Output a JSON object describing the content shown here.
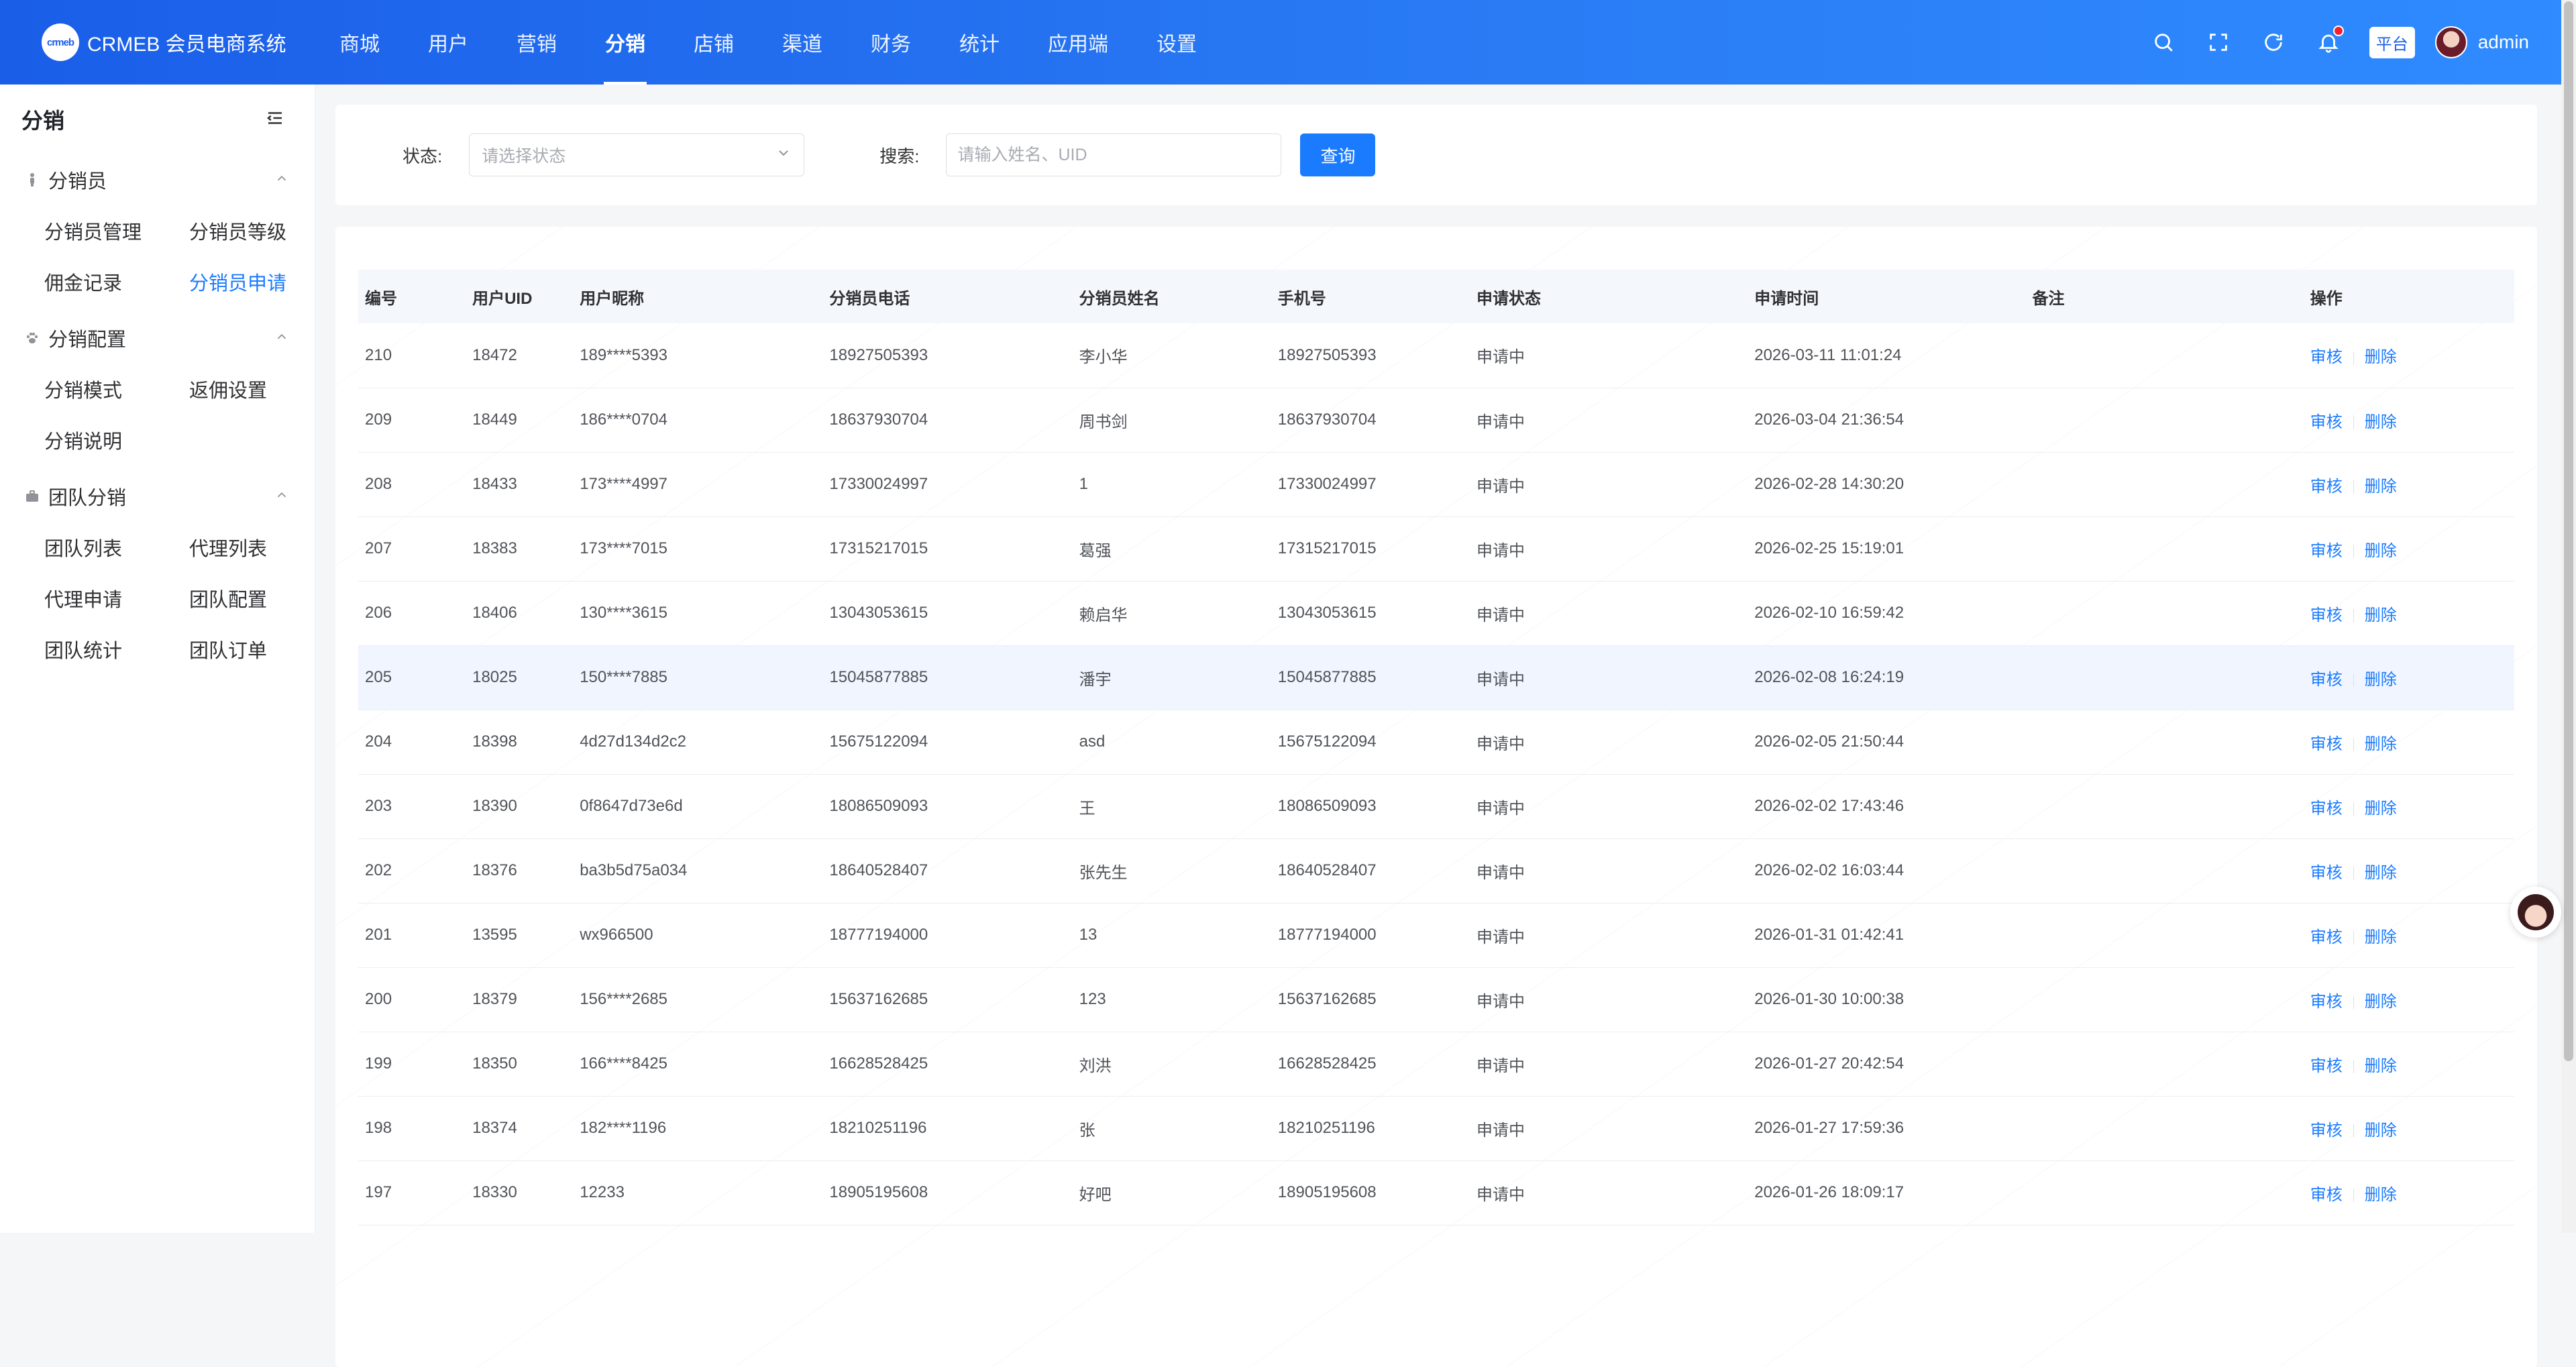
{
  "brand": {
    "logo_text": "crmeb",
    "name": "CRMEB 会员电商系统"
  },
  "top_nav": [
    {
      "label": "商城"
    },
    {
      "label": "用户"
    },
    {
      "label": "营销"
    },
    {
      "label": "分销",
      "active": true
    },
    {
      "label": "店铺"
    },
    {
      "label": "渠道"
    },
    {
      "label": "财务"
    },
    {
      "label": "统计"
    },
    {
      "label": "应用端"
    },
    {
      "label": "设置"
    }
  ],
  "header_right": {
    "platform_tag": "平台",
    "username": "admin"
  },
  "sidebar": {
    "title": "分销",
    "groups": [
      {
        "label": "分销员",
        "icon": "person-icon",
        "items": [
          "分销员管理",
          "分销员等级",
          "佣金记录",
          "分销员申请"
        ]
      },
      {
        "label": "分销配置",
        "icon": "paw-icon",
        "items": [
          "分销模式",
          "返佣设置",
          "分销说明"
        ]
      },
      {
        "label": "团队分销",
        "icon": "briefcase-icon",
        "items": [
          "团队列表",
          "代理列表",
          "代理申请",
          "团队配置",
          "团队统计",
          "团队订单"
        ]
      }
    ],
    "active_item": "分销员申请"
  },
  "filter": {
    "status_label": "状态:",
    "status_placeholder": "请选择状态",
    "search_label": "搜索:",
    "search_placeholder": "请输入姓名、UID",
    "query_button": "查询"
  },
  "table": {
    "headers": [
      "编号",
      "用户UID",
      "用户昵称",
      "分销员电话",
      "分销员姓名",
      "手机号",
      "申请状态",
      "申请时间",
      "备注",
      "操作"
    ],
    "actions": {
      "review": "审核",
      "delete": "删除"
    },
    "rows": [
      [
        "210",
        "18472",
        "189****5393",
        "18927505393",
        "李小华",
        "18927505393",
        "申请中",
        "2026-03-11 11:01:24",
        ""
      ],
      [
        "209",
        "18449",
        "186****0704",
        "18637930704",
        "周书剑",
        "18637930704",
        "申请中",
        "2026-03-04 21:36:54",
        ""
      ],
      [
        "208",
        "18433",
        "173****4997",
        "17330024997",
        "1",
        "17330024997",
        "申请中",
        "2026-02-28 14:30:20",
        ""
      ],
      [
        "207",
        "18383",
        "173****7015",
        "17315217015",
        "葛强",
        "17315217015",
        "申请中",
        "2026-02-25 15:19:01",
        ""
      ],
      [
        "206",
        "18406",
        "130****3615",
        "13043053615",
        "赖启华",
        "13043053615",
        "申请中",
        "2026-02-10 16:59:42",
        ""
      ],
      [
        "205",
        "18025",
        "150****7885",
        "15045877885",
        "潘宇",
        "15045877885",
        "申请中",
        "2026-02-08 16:24:19",
        ""
      ],
      [
        "204",
        "18398",
        "4d27d134d2c2",
        "15675122094",
        "asd",
        "15675122094",
        "申请中",
        "2026-02-05 21:50:44",
        ""
      ],
      [
        "203",
        "18390",
        "0f8647d73e6d",
        "18086509093",
        "王",
        "18086509093",
        "申请中",
        "2026-02-02 17:43:46",
        ""
      ],
      [
        "202",
        "18376",
        "ba3b5d75a034",
        "18640528407",
        "张先生",
        "18640528407",
        "申请中",
        "2026-02-02 16:03:44",
        ""
      ],
      [
        "201",
        "13595",
        "wx966500",
        "18777194000",
        "13",
        "18777194000",
        "申请中",
        "2026-01-31 01:42:41",
        ""
      ],
      [
        "200",
        "18379",
        "156****2685",
        "15637162685",
        "123",
        "15637162685",
        "申请中",
        "2026-01-30 10:00:38",
        ""
      ],
      [
        "199",
        "18350",
        "166****8425",
        "16628528425",
        "刘洪",
        "16628528425",
        "申请中",
        "2026-01-27 20:42:54",
        ""
      ],
      [
        "198",
        "18374",
        "182****1196",
        "18210251196",
        "张",
        "18210251196",
        "申请中",
        "2026-01-27 17:59:36",
        ""
      ],
      [
        "197",
        "18330",
        "12233",
        "18905195608",
        "好吧",
        "18905195608",
        "申请中",
        "2026-01-26 18:09:17",
        ""
      ]
    ],
    "hovered_row_index": 5
  },
  "colors": {
    "primary": "#1a7bff",
    "header_gradient_start": "#1a5ee8",
    "header_gradient_end": "#2f8bff"
  }
}
